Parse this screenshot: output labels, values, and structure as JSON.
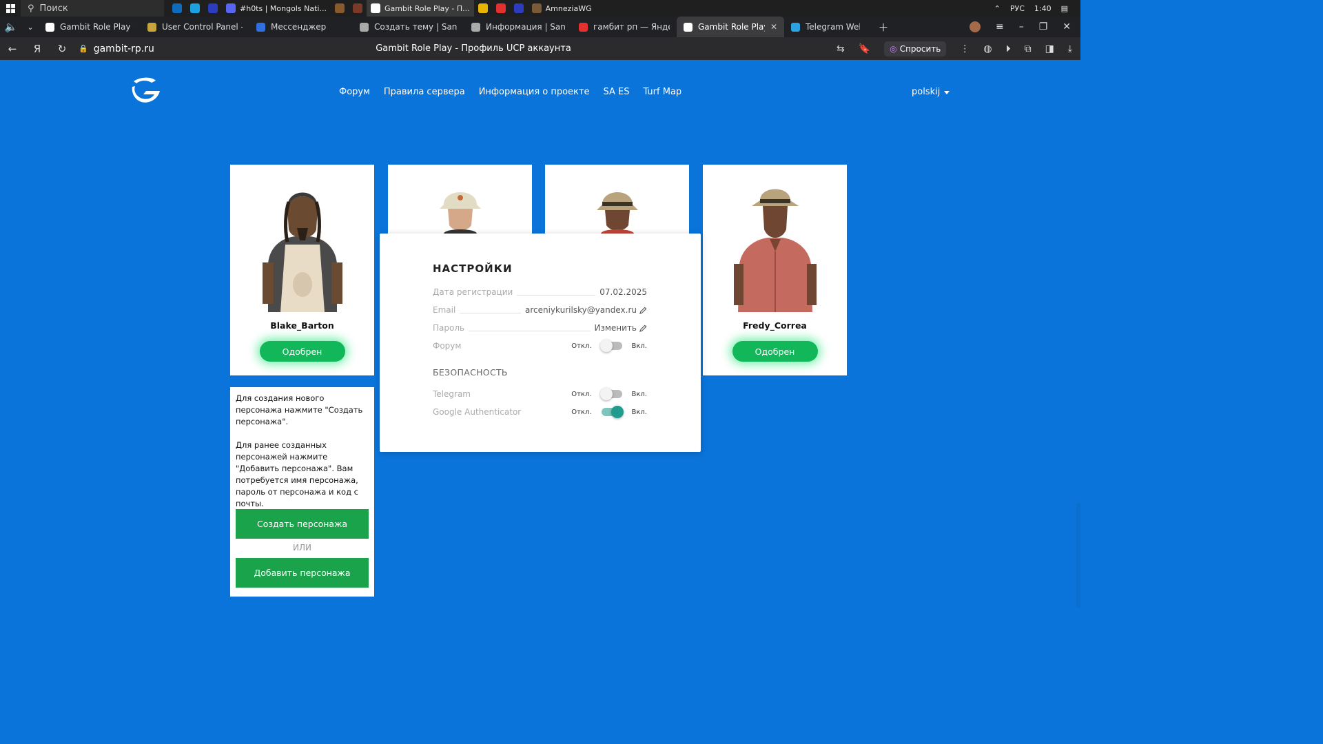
{
  "taskbar": {
    "search_placeholder": "Поиск",
    "apps": [
      {
        "label": "",
        "color": "#0f6cbd"
      },
      {
        "label": "",
        "color": "#1ba0e0"
      },
      {
        "label": "",
        "color": "#2c3cbf"
      },
      {
        "label": "#h0ts | Mongols Nati...",
        "color": "#5865f2"
      },
      {
        "label": "",
        "color": "#8a5a2c"
      },
      {
        "label": "",
        "color": "#7a3a2a"
      },
      {
        "label": "Gambit Role Play - П...",
        "color": "#ffffff",
        "active": true
      },
      {
        "label": "",
        "color": "#e8b400"
      },
      {
        "label": "",
        "color": "#e53030"
      },
      {
        "label": "",
        "color": "#2c3cbf"
      },
      {
        "label": "AmneziaWG",
        "color": "#7b5a3a"
      }
    ],
    "language": "РУС",
    "time": "1:40"
  },
  "tabs": [
    {
      "label": "Gambit Role Play - Форум",
      "color": "#ffffff"
    },
    {
      "label": "User Control Panel - GTA",
      "color": "#c9a43a"
    },
    {
      "label": "Мессенджер",
      "color": "#2f6fe0"
    },
    {
      "label": "Создать тему | San Andr",
      "color": "#aaaaaa"
    },
    {
      "label": "Информация | San Andr",
      "color": "#aaaaaa"
    },
    {
      "label": "гамбит рп — Яндекс: нас",
      "color": "#e53030"
    },
    {
      "label": "Gambit Role Play - Про",
      "color": "#ffffff",
      "active": true
    },
    {
      "label": "Telegram Web",
      "color": "#2aa3e0"
    }
  ],
  "address": {
    "url": "gambit-rp.ru",
    "page_title": "Gambit Role Play - Профиль UCP аккаунта",
    "ask_label": "Спросить"
  },
  "site": {
    "nav": [
      "Форум",
      "Правила сервера",
      "Информация о проекте",
      "SA ES",
      "Turf Map"
    ],
    "language": "polskij"
  },
  "characters": [
    {
      "name": "Blake_Barton",
      "status": "Одобрен"
    },
    {
      "name": "",
      "status": ""
    },
    {
      "name": "",
      "status": ""
    },
    {
      "name": "Fredy_Correa",
      "status": "Одобрен"
    }
  ],
  "info": {
    "text1": "Для создания нового персонажа нажмите \"Создать персонажа\".",
    "text2": "Для ранее созданных персонажей нажмите \"Добавить персонажа\". Вам потребуется имя персонажа, пароль от персонажа и код с почты.",
    "create_label": "Создать персонажа",
    "or_label": "ИЛИ",
    "add_label": "Добавить персонажа"
  },
  "settings": {
    "title": "НАСТРОЙКИ",
    "reg_label": "Дата регистрации",
    "reg_value": "07.02.2025",
    "email_label": "Email",
    "email_value": "arceniykurilsky@yandex.ru",
    "password_label": "Пароль",
    "password_value": "Изменить",
    "forum_label": "Форум",
    "off_label": "Откл.",
    "on_label": "Вкл.",
    "security_title": "БЕЗОПАСНОСТЬ",
    "telegram_label": "Telegram",
    "ga_label": "Google Authenticator",
    "forum_enabled": false,
    "telegram_enabled": false,
    "ga_enabled": true
  }
}
